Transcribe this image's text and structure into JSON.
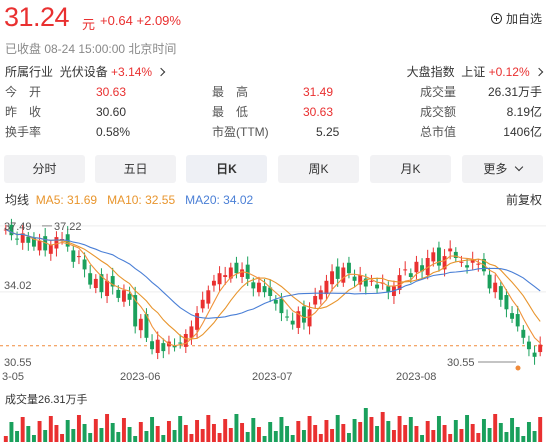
{
  "header": {
    "price": "31.24",
    "unit": "元",
    "change": "+0.64 +2.09%",
    "watch_label": "加自选"
  },
  "status": "已收盘  08-24 15:00:00  北京时间",
  "industry": {
    "label": "所属行业",
    "name": "光伏设备",
    "change": "+3.14%"
  },
  "index": {
    "label": "大盘指数",
    "name": "上证",
    "change": "+0.12%"
  },
  "stats": [
    {
      "label": "今　开",
      "value": "30.63",
      "color": "red"
    },
    {
      "label": "最　高",
      "value": "31.49",
      "color": "red"
    },
    {
      "label": "成交量",
      "value": "26.31万手",
      "color": "dark"
    },
    {
      "label": "昨　收",
      "value": "30.60",
      "color": "dark"
    },
    {
      "label": "最　低",
      "value": "30.63",
      "color": "red"
    },
    {
      "label": "成交额",
      "value": "8.19亿",
      "color": "dark"
    },
    {
      "label": "换手率",
      "value": "0.58%",
      "color": "dark"
    },
    {
      "label": "市盈(TTM)",
      "value": "5.25",
      "color": "dark"
    },
    {
      "label": "总市值",
      "value": "1406亿",
      "color": "dark"
    }
  ],
  "tabs": [
    "分时",
    "五日",
    "日K",
    "周K",
    "月K",
    "更多"
  ],
  "active_tab": "日K",
  "ma": {
    "prefix": "均线",
    "ma5": "MA5: 31.69",
    "ma10": "MA10: 32.55",
    "ma20": "MA20: 34.02",
    "ma5_color": "#e8952d",
    "ma10_color": "#e8952d",
    "ma20_color": "#4a7fd6"
  },
  "adjust": "前复权",
  "chart_data": {
    "type": "candlestick",
    "x_ticks": [
      "3-05",
      "2023-06",
      "2023-07",
      "2023-08"
    ],
    "y_labels": {
      "high": "37.49",
      "mid": "34.02",
      "low": "30.55"
    },
    "annotations": {
      "max": "37.22",
      "min": "30.55"
    },
    "colors": {
      "up": "#e93030",
      "down": "#1aa05c",
      "ma_short": "#f0923a",
      "ma_mid": "#e8952d",
      "ma_long": "#4a7fd6"
    },
    "volume_label": "成交量26.31万手"
  }
}
